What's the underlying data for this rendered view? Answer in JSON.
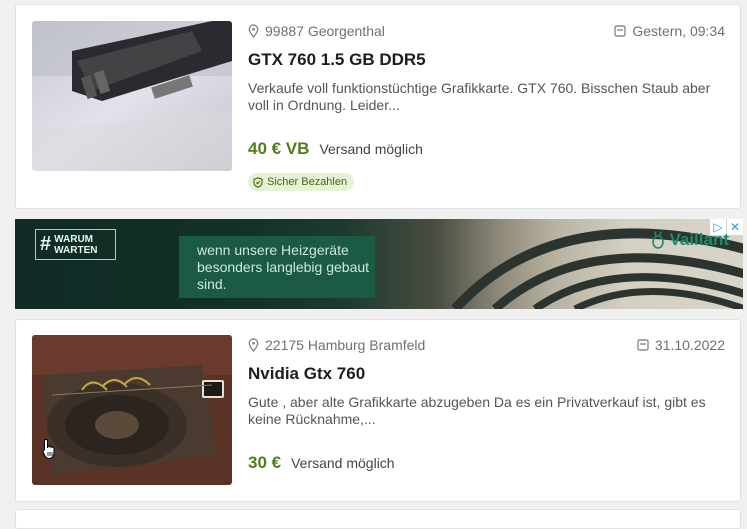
{
  "listings": [
    {
      "location": "99887 Georgenthal",
      "date": "Gestern, 09:34",
      "title": "GTX 760 1.5 GB DDR5",
      "description": "Verkaufe voll funktionstüchtige Grafikkarte. GTX 760. Bisschen Staub aber voll in Ordnung. Leider...",
      "price": "40 € VB",
      "shipping": "Versand möglich",
      "badge": "Sicher Bezahlen"
    },
    {
      "location": "22175 Hamburg Bramfeld",
      "date": "31.10.2022",
      "title": "Nvidia Gtx 760",
      "description": "Gute , aber alte Grafikkarte abzugeben Da es ein Privatverkauf ist, gibt es keine Rücknahme,...",
      "price": "30 €",
      "shipping": "Versand möglich"
    }
  ],
  "ad": {
    "tag_line1": "WARUM",
    "tag_line2": "WARTEN",
    "text": "wenn unsere Heizgeräte besonders langlebig gebaut sind.",
    "brand": "Vaillant",
    "ad_choices": "▷",
    "close": "✕"
  },
  "colors": {
    "price": "#4f7d1b",
    "badge_bg": "#e6f2d6",
    "ad_panel": "#1b5a44"
  }
}
